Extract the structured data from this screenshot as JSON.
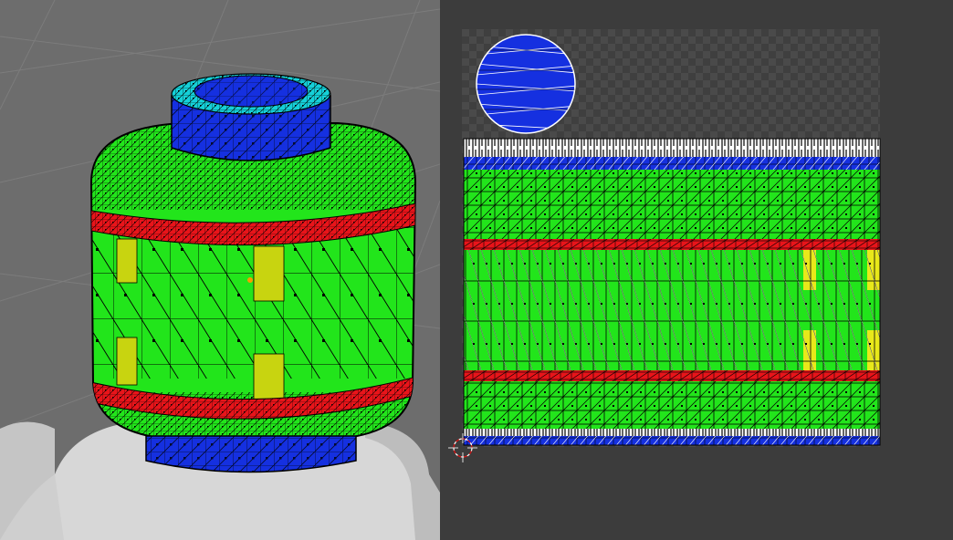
{
  "colors": {
    "viewport_bg": "#6d6d6d",
    "editor_bg": "#3c3c3c",
    "checker_dark": "#3f3f3f",
    "checker_light": "#4a4a4a",
    "face_green": "#22e51b",
    "face_red": "#e8141a",
    "face_blue": "#1530e0",
    "face_yellow": "#c8d410",
    "face_cyan": "#15d0d8",
    "wire": "#000000"
  },
  "icons": {
    "cursor": "uv-2d-cursor-icon"
  }
}
